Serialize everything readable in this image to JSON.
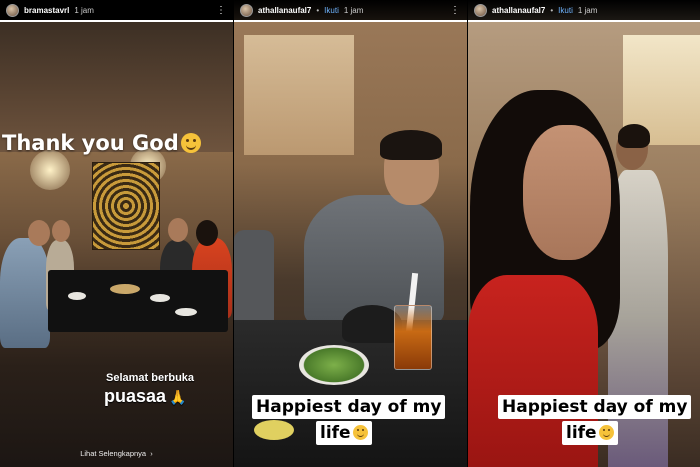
{
  "stories": [
    {
      "username": "bramastavrl",
      "time": "1 jam",
      "headline": "Thank you God",
      "caption_line1": "Selamat berbuka",
      "caption_line2": "puasaa",
      "see_more": "Lihat Selengkapnya",
      "progress": 1.0
    },
    {
      "username": "athallanaufal7",
      "follow": "Ikuti",
      "time": "1 jam",
      "label_line1": "Happiest day of my",
      "label_line2": "life",
      "progress": 1.0
    },
    {
      "username": "athallanaufal7",
      "follow": "Ikuti",
      "time": "1 jam",
      "label_line1": "Happiest day of my",
      "label_line2": "life",
      "progress": 1.0
    }
  ],
  "icons": {
    "more": "more-options-icon",
    "emoji_smile": "smiling-face-emoji",
    "emoji_pray": "folded-hands-emoji",
    "chevron": "chevron-right-icon"
  },
  "colors": {
    "follow_link": "#6fb4ff",
    "background": "#000000"
  }
}
